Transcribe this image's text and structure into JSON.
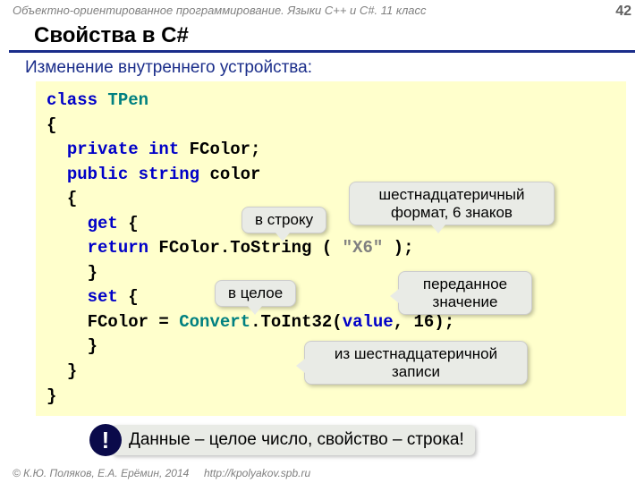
{
  "header": {
    "course": "Объектно-ориентированное программирование. Языки C++ и C#. 11 класс",
    "page": "42"
  },
  "title": "Свойства в C#",
  "subtitle": "Изменение внутреннего устройства:",
  "code": {
    "l1_kw": "class",
    "l1_cls": " TPen",
    "l2": "{",
    "l3_kw": "private int",
    "l3_id": " FColor;",
    "l4_kw": "public string",
    "l4_id": " color",
    "l5": "{",
    "l6_kw": "get",
    "l6_rest": " {",
    "l7_kw": "return",
    "l7_mid": " FColor.ToString ( ",
    "l7_str": "\"X6\"",
    "l7_end": " );",
    "l8": "}",
    "l9_kw": "set",
    "l9_rest": " {",
    "l10_a": "FColor = ",
    "l10_conv": "Convert",
    "l10_b": ".ToInt32(",
    "l10_val": "value",
    "l10_c": ", 16);",
    "l11": "}",
    "l12": "}",
    "l13": "}"
  },
  "callouts": {
    "to_string": "в строку",
    "hex_format": "шестнадцатеричный\nформат, 6 знаков",
    "to_int": "в целое",
    "passed_value": "переданное\nзначение",
    "from_hex": "из шестнадцатеричной\nзаписи"
  },
  "note": {
    "bang": "!",
    "text": "Данные – целое число, свойство – строка!"
  },
  "footer": {
    "copyright": "© К.Ю. Поляков, Е.А. Ерёмин, 2014",
    "url": "http://kpolyakov.spb.ru"
  }
}
